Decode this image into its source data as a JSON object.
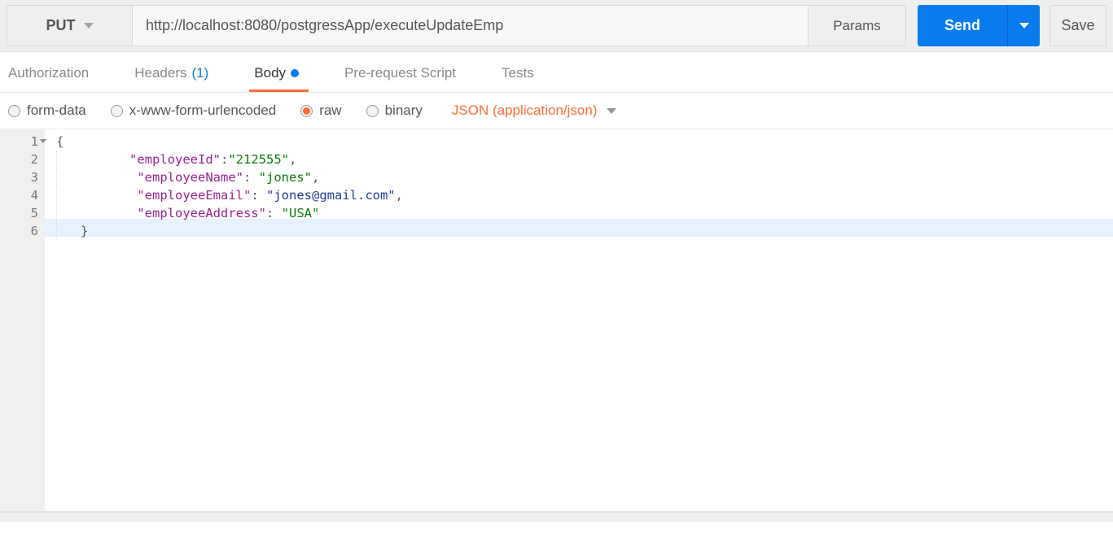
{
  "request": {
    "method": "PUT",
    "url": "http://localhost:8080/postgressApp/executeUpdateEmp",
    "params_label": "Params",
    "send_label": "Send",
    "save_label": "Save"
  },
  "tabs": {
    "authorization": "Authorization",
    "headers_label": "Headers",
    "headers_count": "(1)",
    "body": "Body",
    "prerequest": "Pre-request Script",
    "tests": "Tests",
    "active": "Body"
  },
  "body_type": {
    "form_data": "form-data",
    "urlencoded": "x-www-form-urlencoded",
    "raw": "raw",
    "binary": "binary",
    "selected": "raw",
    "content_type": "JSON (application/json)"
  },
  "editor": {
    "line_numbers": [
      "1",
      "2",
      "3",
      "4",
      "5",
      "6"
    ],
    "lines": [
      {
        "type": "open",
        "text": "{"
      },
      {
        "type": "kv",
        "key": "\"employeeId\"",
        "val": "\"212555\"",
        "trail": ","
      },
      {
        "type": "kv",
        "key": "\"employeeName\"",
        "val": "\"jones\"",
        "trail": ","
      },
      {
        "type": "kv",
        "key": "\"employeeEmail\"",
        "val": "\"jones@gmail.com\"",
        "trail": ",",
        "email": true
      },
      {
        "type": "kv",
        "key": "\"employeeAddress\"",
        "val": "\"USA\"",
        "trail": ""
      },
      {
        "type": "close",
        "text": "}"
      }
    ]
  }
}
